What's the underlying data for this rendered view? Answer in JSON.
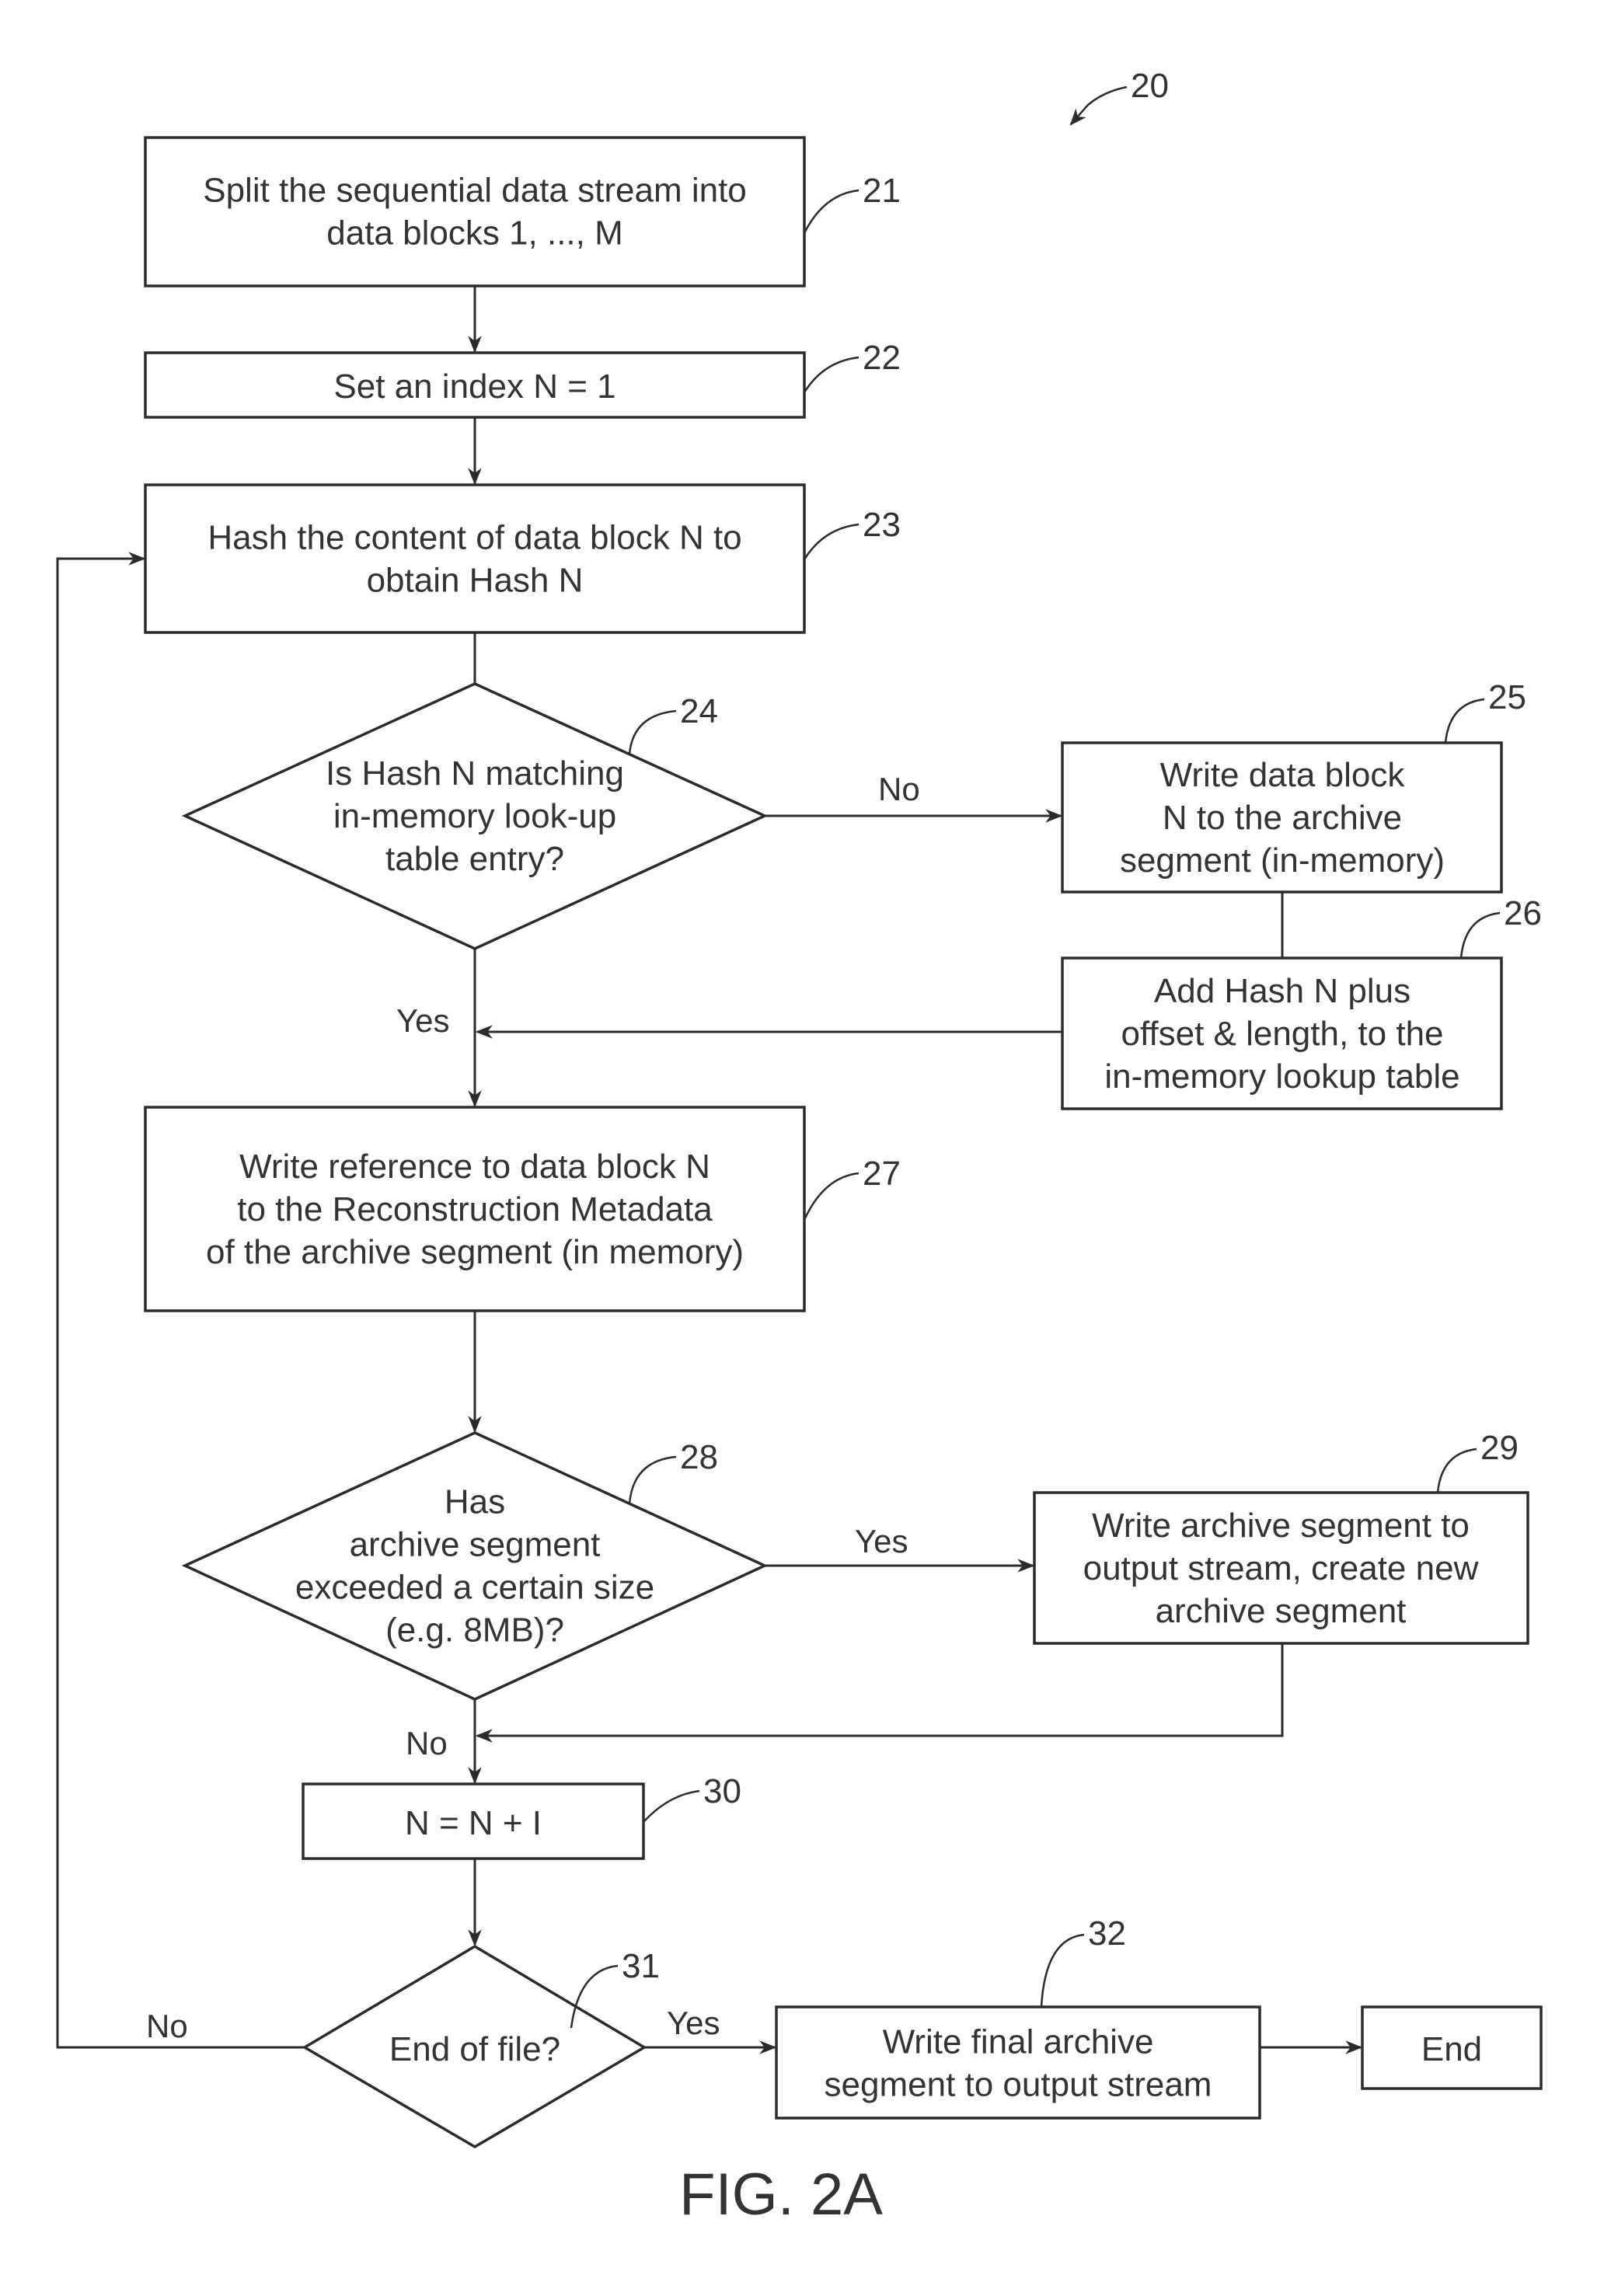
{
  "figure": {
    "caption": "FIG. 2A",
    "reference": "20"
  },
  "nodes": {
    "n21": {
      "ref": "21",
      "type": "process",
      "lines": [
        "Split the sequential data stream into",
        "data blocks 1, ..., M"
      ]
    },
    "n22": {
      "ref": "22",
      "type": "process",
      "lines": [
        "Set an index N = 1"
      ]
    },
    "n23": {
      "ref": "23",
      "type": "process",
      "lines": [
        "Hash the content of data block N to",
        "obtain Hash N"
      ]
    },
    "n24": {
      "ref": "24",
      "type": "decision",
      "lines": [
        "Is Hash N matching",
        "in-memory look-up",
        "table entry?"
      ]
    },
    "n25": {
      "ref": "25",
      "type": "process",
      "lines": [
        "Write data block",
        "N to the archive",
        "segment (in-memory)"
      ]
    },
    "n26": {
      "ref": "26",
      "type": "process",
      "lines": [
        "Add Hash N plus",
        "offset & length, to the",
        "in-memory lookup table"
      ]
    },
    "n27": {
      "ref": "27",
      "type": "process",
      "lines": [
        "Write reference to data block N",
        "to the Reconstruction Metadata",
        "of the archive segment (in memory)"
      ]
    },
    "n28": {
      "ref": "28",
      "type": "decision",
      "lines": [
        "Has",
        "archive segment",
        "exceeded a certain size",
        "(e.g. 8MB)?"
      ]
    },
    "n29": {
      "ref": "29",
      "type": "process",
      "lines": [
        "Write archive segment to",
        "output stream, create new",
        "archive segment"
      ]
    },
    "n30": {
      "ref": "30",
      "type": "process",
      "lines": [
        "N = N + I"
      ]
    },
    "n31": {
      "ref": "31",
      "type": "decision",
      "lines": [
        "End of file?"
      ]
    },
    "n32": {
      "ref": "32",
      "type": "process",
      "lines": [
        "Write final archive",
        "segment to output stream"
      ]
    },
    "end": {
      "type": "terminal",
      "lines": [
        "End"
      ]
    }
  },
  "edge_labels": {
    "n24_no": "No",
    "n24_yes": "Yes",
    "n28_yes": "Yes",
    "n28_no": "No",
    "n31_no": "No",
    "n31_yes": "Yes"
  }
}
